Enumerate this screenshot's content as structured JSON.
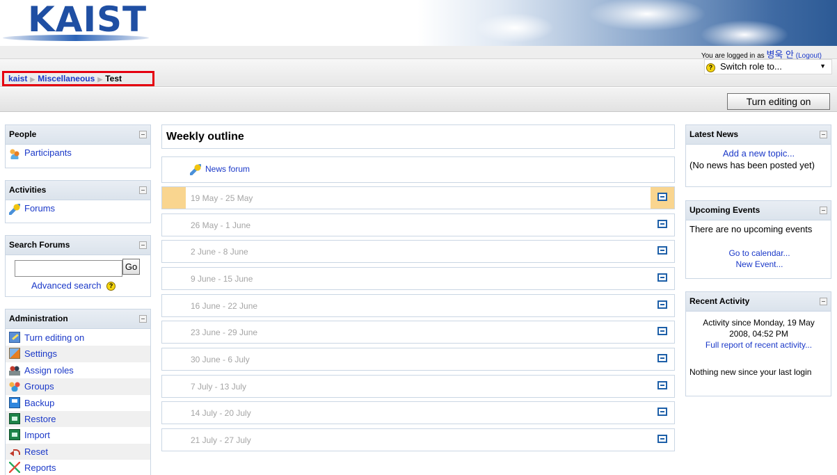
{
  "header": {
    "logo_text": "KAIST"
  },
  "login": {
    "prefix": "You are logged in as",
    "username": "병욱 안",
    "logout": "(Logout)"
  },
  "breadcrumb": {
    "items": [
      "kaist",
      "Miscellaneous",
      "Test"
    ]
  },
  "role_switch": {
    "label": "Switch role to..."
  },
  "edit_button": {
    "label": "Turn editing on"
  },
  "people": {
    "title": "People",
    "participants": "Participants"
  },
  "activities": {
    "title": "Activities",
    "forums": "Forums"
  },
  "search_forums": {
    "title": "Search Forums",
    "go": "Go",
    "advanced": "Advanced search",
    "query": ""
  },
  "administration": {
    "title": "Administration",
    "items": [
      "Turn editing on",
      "Settings",
      "Assign roles",
      "Groups",
      "Backup",
      "Restore",
      "Import",
      "Reset",
      "Reports"
    ]
  },
  "weekly": {
    "title": "Weekly outline",
    "news_forum": "News forum",
    "weeks": [
      "19 May - 25 May",
      "26 May - 1 June",
      "2 June - 8 June",
      "9 June - 15 June",
      "16 June - 22 June",
      "23 June - 29 June",
      "30 June - 6 July",
      "7 July - 13 July",
      "14 July - 20 July",
      "21 July - 27 July"
    ]
  },
  "latest_news": {
    "title": "Latest News",
    "add_topic": "Add a new topic...",
    "empty": "(No news has been posted yet)"
  },
  "upcoming": {
    "title": "Upcoming Events",
    "empty": "There are no upcoming events",
    "calendar": "Go to calendar...",
    "new_event": "New Event..."
  },
  "recent": {
    "title": "Recent Activity",
    "since": "Activity since Monday, 19 May 2008, 04:52 PM",
    "full_report": "Full report of recent activity...",
    "nothing": "Nothing new since your last login"
  },
  "colors": {
    "link": "#1a38c8",
    "logo": "#1f4fa3",
    "current_week": "#f9d58f",
    "breadcrumb_outline": "#e5000f"
  }
}
